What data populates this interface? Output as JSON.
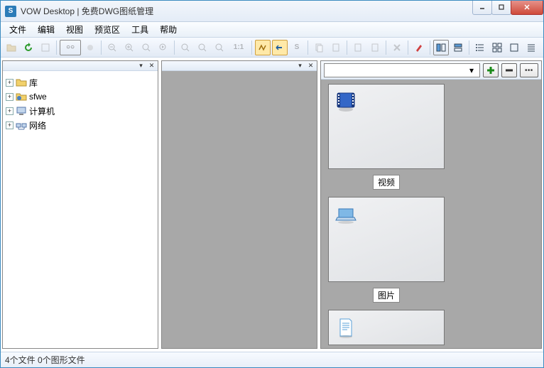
{
  "title": "VOW Desktop | 免费DWG图纸管理",
  "menu": [
    "文件",
    "编辑",
    "视图",
    "预览区",
    "工具",
    "帮助"
  ],
  "tree": [
    {
      "label": "库",
      "icon": "folder"
    },
    {
      "label": "sfwe",
      "icon": "folder-blue"
    },
    {
      "label": "计算机",
      "icon": "computer"
    },
    {
      "label": "网络",
      "icon": "network"
    }
  ],
  "thumbs": [
    {
      "label": "视频",
      "icon": "video"
    },
    {
      "label": "图片",
      "icon": "laptop"
    },
    {
      "label": "",
      "icon": "doc"
    }
  ],
  "status": "4个文件 0个图形文件",
  "toolbar_ratio": "1:1"
}
